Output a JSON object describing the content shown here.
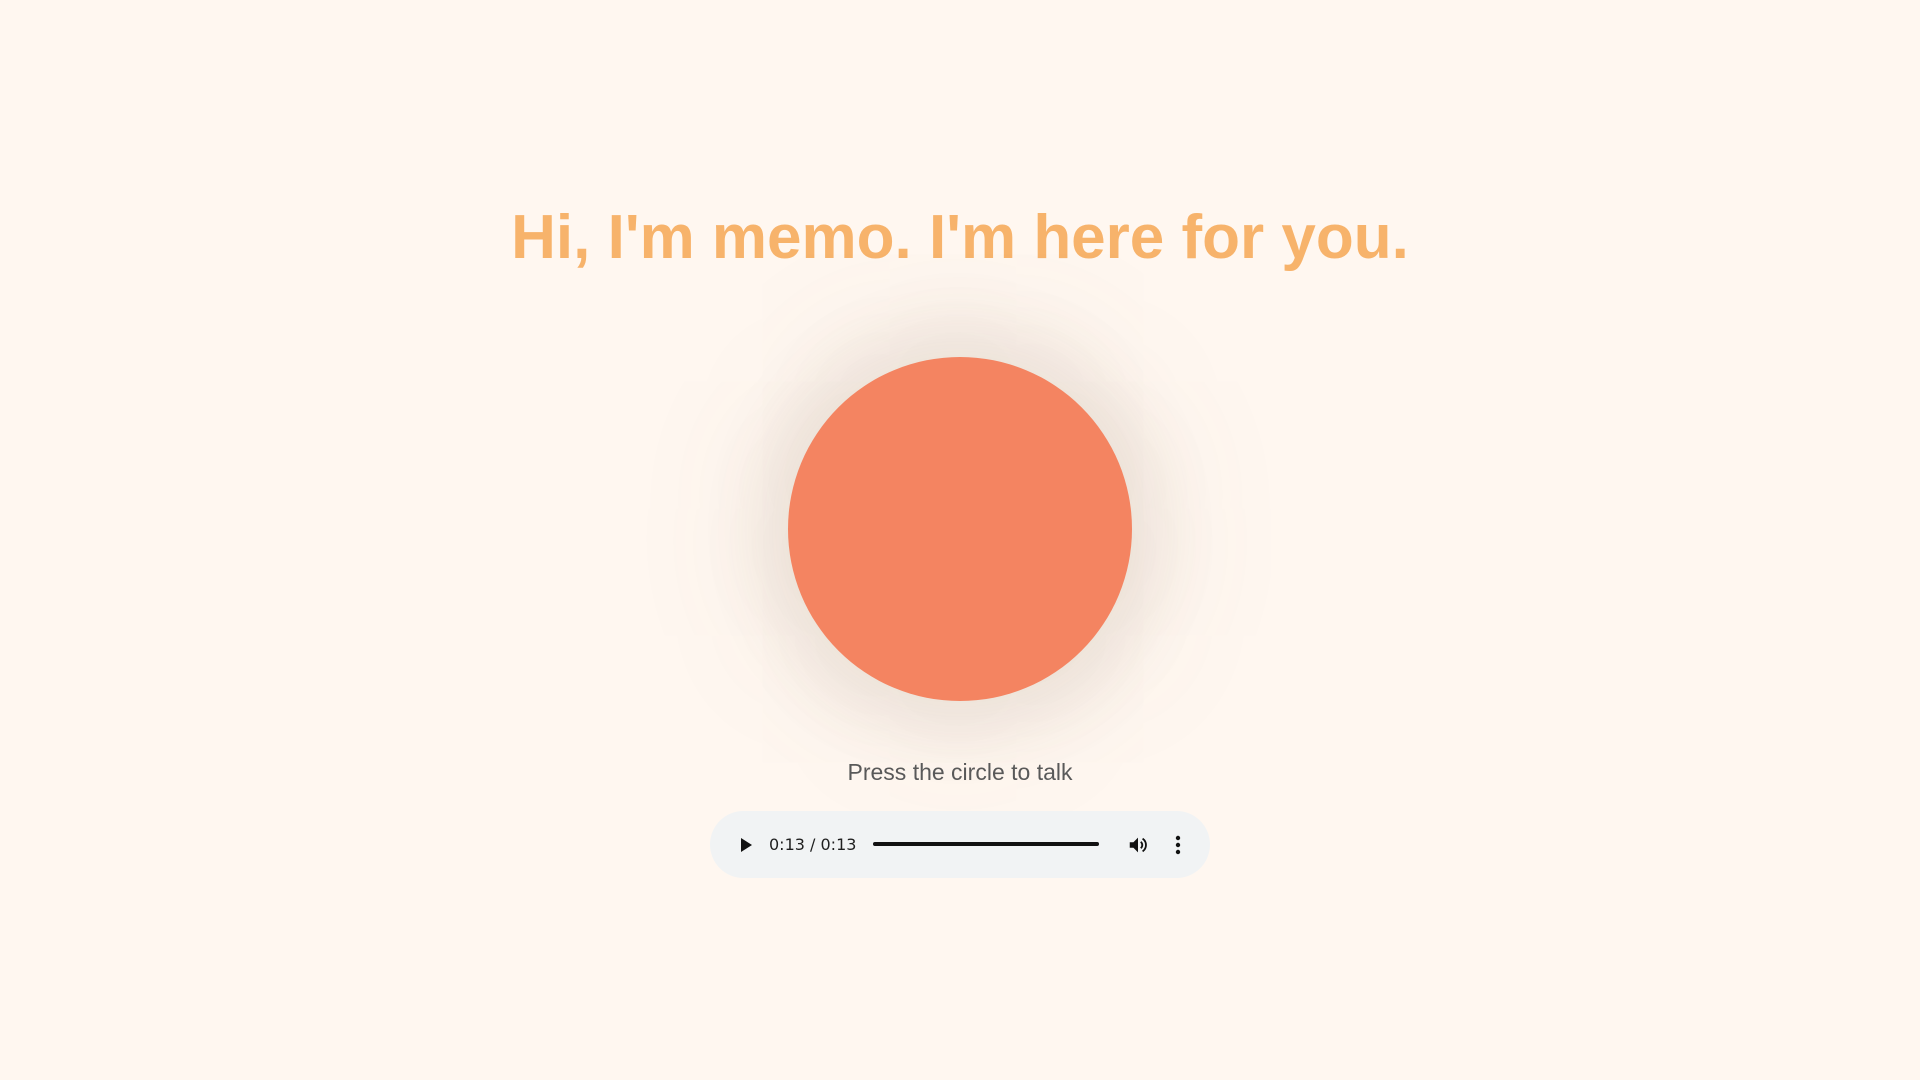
{
  "header": {
    "title": "Hi, I'm memo. I'm here for you."
  },
  "talk": {
    "instruction": "Press the circle to talk"
  },
  "audio": {
    "time_display": "0:13 / 0:13",
    "progress_fraction": 1.0
  },
  "icons": {
    "play": "play-icon",
    "volume": "volume-icon",
    "more": "more-options-icon"
  },
  "colors": {
    "background": "#fff7f0",
    "headline": "#f7b36b",
    "circle": "#f48461",
    "instruction_text": "#595959",
    "player_background": "#f1f3f4"
  }
}
